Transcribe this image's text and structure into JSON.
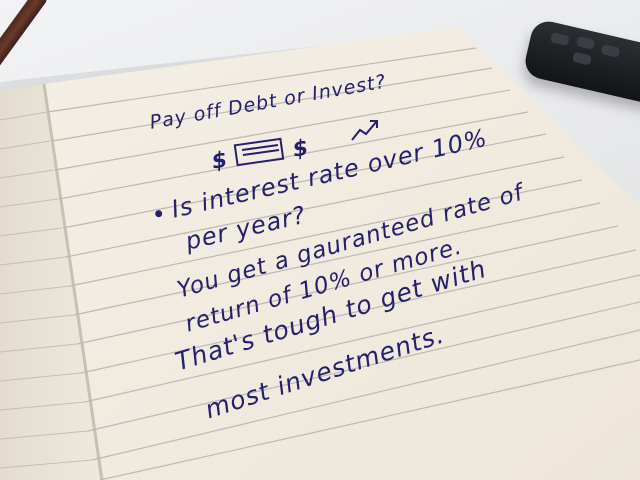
{
  "notebook": {
    "heading": "Pay off Debt or Invest?",
    "heading_doodle_left": "$",
    "heading_doodle_right": "$",
    "bullet": "•",
    "question_line_1": "Is interest rate over 10%",
    "question_line_2": "per year?",
    "answer_line_1": "You get a gauranteed rate of",
    "answer_line_2": "return of 10% or more.",
    "answer_line_3": "That's tough to get with",
    "answer_line_4": "most investments."
  },
  "colors": {
    "paper": "#f1ece1",
    "paper_left": "#ebe4d8",
    "rule_line": "#b8b5b0",
    "ink": "#24206b",
    "ribbon": "#5b3326",
    "remote": "#1a1c1f",
    "desk": "#e7e8ea"
  },
  "icons": {
    "chart": "trend-arrow-icon",
    "money": "banknote-icon"
  }
}
